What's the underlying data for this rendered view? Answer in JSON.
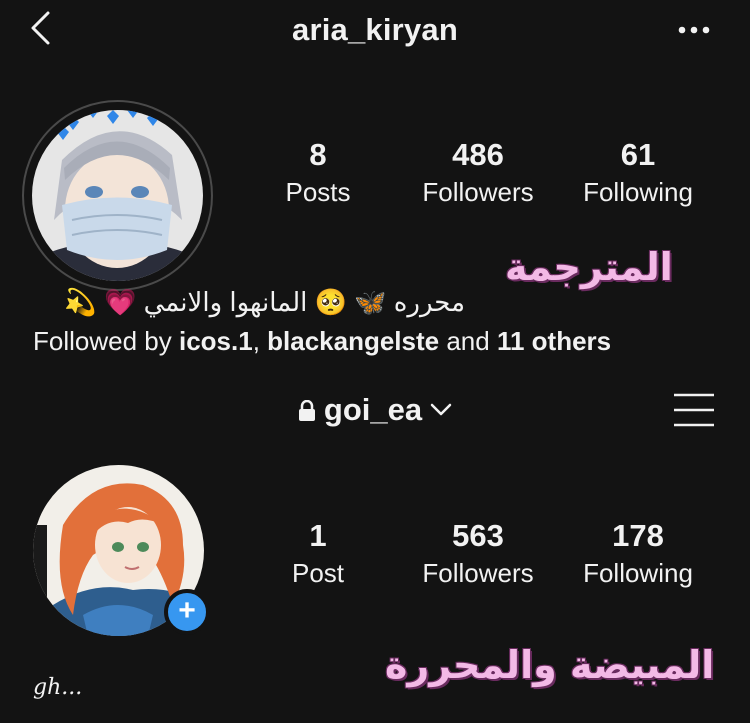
{
  "top": {
    "username": "aria_kiryan"
  },
  "profile1": {
    "stats": [
      {
        "num": "8",
        "label": "Posts"
      },
      {
        "num": "486",
        "label": "Followers"
      },
      {
        "num": "61",
        "label": "Following"
      }
    ],
    "bio": "محرره 🦋 🥺 المانهوا والانمي 💗 💫",
    "followed_prefix": "Followed by ",
    "followed_user1": "icos.1",
    "followed_sep": ", ",
    "followed_user2": "blackangelste",
    "followed_and": " and ",
    "followed_others": "11 others"
  },
  "overlay": {
    "label1": "المترجمة",
    "label2": "المبيضة والمحررة"
  },
  "account_switcher": {
    "username": "goi_ea"
  },
  "profile2": {
    "stats": [
      {
        "num": "1",
        "label": "Post"
      },
      {
        "num": "563",
        "label": "Followers"
      },
      {
        "num": "178",
        "label": "Following"
      }
    ],
    "plus": "+",
    "bio": "gh..."
  },
  "colors": {
    "background": "#131313",
    "accent_blue": "#3797f0",
    "overlay_pink": "#f3b9e6"
  }
}
